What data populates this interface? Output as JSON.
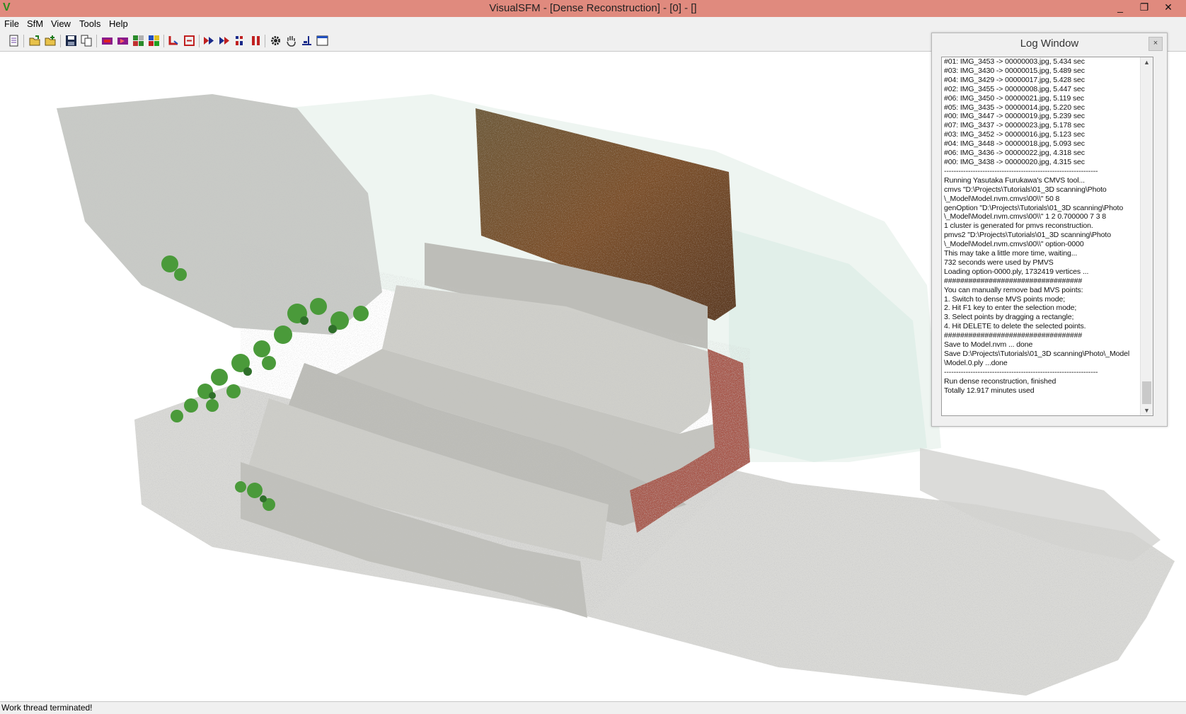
{
  "window": {
    "title": "VisualSFM - [Dense Reconstruction] - [0] - []",
    "minimize_label": "_",
    "restore_label": "❐",
    "close_label": "✕"
  },
  "menu": [
    "File",
    "SfM",
    "View",
    "Tools",
    "Help"
  ],
  "toolbar": {
    "icons": [
      "log-window-icon",
      "open-images-icon",
      "open-model-icon",
      "save-icon",
      "copy-icon",
      "pairwise-match-icon",
      "compute-missing-match-icon",
      "show-matches-icon",
      "thumbnail-view-icon",
      "reconstruct-icon",
      "remove-cameras-icon",
      "run-sfm-icon",
      "run-dense-icon",
      "step-icon",
      "pause-icon",
      "settings-gear-icon",
      "pan-hand-icon",
      "mode-icon",
      "window-icon"
    ]
  },
  "log_window": {
    "title": "Log Window",
    "close_label": "×",
    "lines": [
      "#01: IMG_3453 -> 00000003.jpg, 5.434 sec",
      "#03: IMG_3430 -> 00000015.jpg, 5.489 sec",
      "#04: IMG_3429 -> 00000017.jpg, 5.428 sec",
      "#02: IMG_3455 -> 00000008.jpg, 5.447 sec",
      "#06: IMG_3450 -> 00000021.jpg, 5.119 sec",
      "#05: IMG_3435 -> 00000014.jpg, 5.220 sec",
      "#00: IMG_3447 -> 00000019.jpg, 5.239 sec",
      "#07: IMG_3437 -> 00000023.jpg, 5.178 sec",
      "#03: IMG_3452 -> 00000016.jpg, 5.123 sec",
      "#04: IMG_3448 -> 00000018.jpg, 5.093 sec",
      "#06: IMG_3436 -> 00000022.jpg, 4.318 sec",
      "#00: IMG_3438 -> 00000020.jpg, 4.315 sec",
      "----------------------------------------------------------------",
      "Running Yasutaka Furukawa's CMVS tool...",
      "cmvs \"D:\\Projects\\Tutorials\\01_3D scanning\\Photo",
      "\\_Model\\Model.nvm.cmvs\\00\\\\\" 50 8",
      "genOption \"D:\\Projects\\Tutorials\\01_3D scanning\\Photo",
      "\\_Model\\Model.nvm.cmvs\\00\\\\\" 1 2 0.700000 7 3 8",
      "1 cluster is generated for pmvs reconstruction.",
      "pmvs2 \"D:\\Projects\\Tutorials\\01_3D scanning\\Photo",
      "\\_Model\\Model.nvm.cmvs\\00\\\\\" option-0000",
      "This may take a little more time, waiting...",
      "732 seconds were used by PMVS",
      "Loading option-0000.ply, 1732419 vertices ...",
      "##################################",
      "You can manually remove bad MVS points:",
      "1. Switch to dense MVS points mode;",
      "2. Hit F1 key to enter the selection mode;",
      "3. Select points by dragging a rectangle;",
      "4. Hit DELETE to delete the selected points.",
      "##################################",
      "Save to Model.nvm ... done",
      "Save D:\\Projects\\Tutorials\\01_3D scanning\\Photo\\_Model",
      "\\Model.0.ply ...done",
      "----------------------------------------------------------------",
      "Run dense reconstruction, finished",
      "Totally 12.917 minutes used"
    ]
  },
  "status": "Work thread terminated!"
}
